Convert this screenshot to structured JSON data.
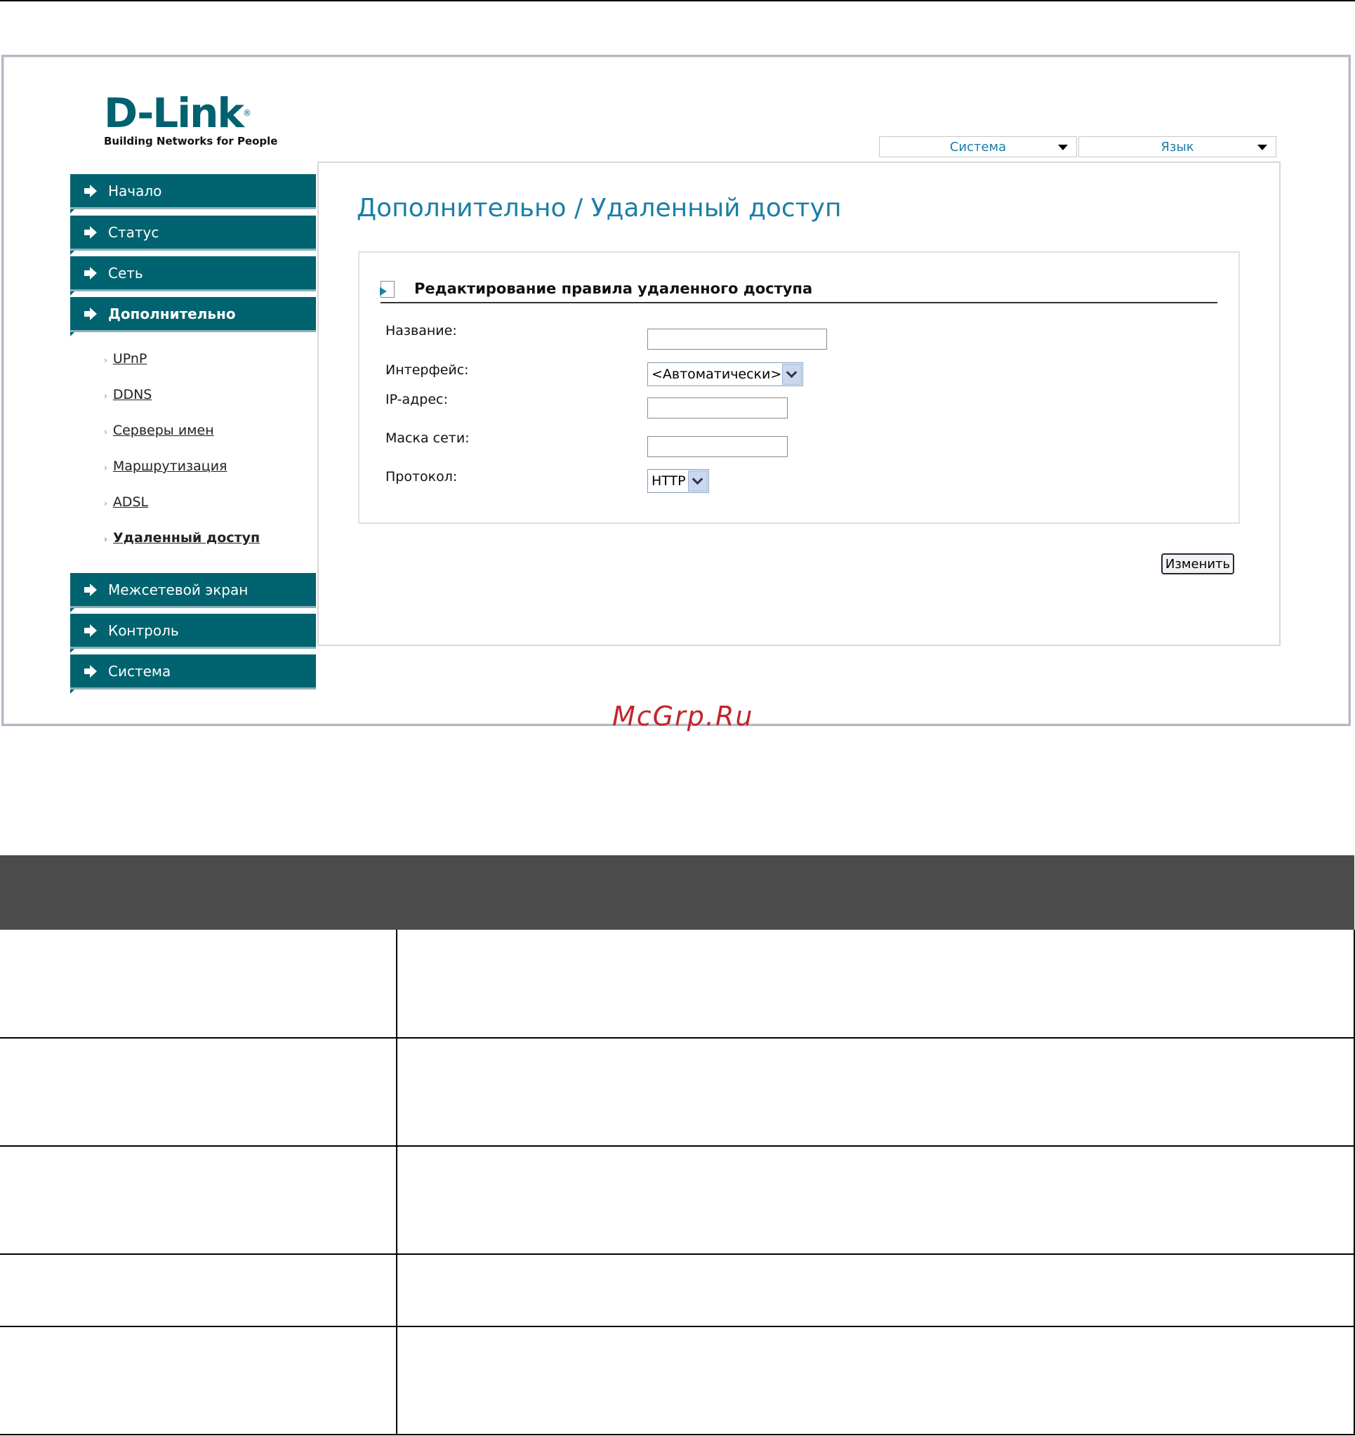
{
  "logo": {
    "brand": "D-Link",
    "tagline": "Building Networks for People"
  },
  "top_menus": [
    {
      "label": "Система"
    },
    {
      "label": "Язык"
    }
  ],
  "sidebar": {
    "main_items": [
      {
        "label": "Начало"
      },
      {
        "label": "Статус"
      },
      {
        "label": "Сеть"
      },
      {
        "label": "Дополнительно"
      }
    ],
    "sub_items": [
      {
        "label": "UPnP"
      },
      {
        "label": "DDNS"
      },
      {
        "label": "Серверы имен"
      },
      {
        "label": "Маршрутизация"
      },
      {
        "label": "ADSL"
      },
      {
        "label": "Удаленный доступ"
      }
    ],
    "lower_items": [
      {
        "label": "Межсетевой экран"
      },
      {
        "label": "Контроль"
      },
      {
        "label": "Система"
      }
    ]
  },
  "page": {
    "title": "Дополнительно / Удаленный доступ",
    "section_title": "Редактирование правила удаленного доступа"
  },
  "form": {
    "name_label": "Название:",
    "name_value": "",
    "interface_label": "Интерфейс:",
    "interface_value": "<Автоматически>",
    "ip_label": "IP-адрес:",
    "ip_value": "",
    "mask_label": "Маска сети:",
    "mask_value": "",
    "protocol_label": "Протокол:",
    "protocol_value": "HTTP",
    "submit_label": "Изменить"
  },
  "watermark": "McGrp.Ru",
  "table": {
    "rows": [
      {
        "param": "",
        "desc": ""
      },
      {
        "param": "",
        "desc": ""
      },
      {
        "param": "",
        "desc": ""
      },
      {
        "param": "",
        "desc": ""
      },
      {
        "param": "",
        "desc": ""
      }
    ]
  },
  "colors": {
    "nav_bg": "#00636f",
    "accent_text": "#1a7fa6",
    "table_header": "#4b4b4b",
    "watermark": "#c0262d"
  }
}
